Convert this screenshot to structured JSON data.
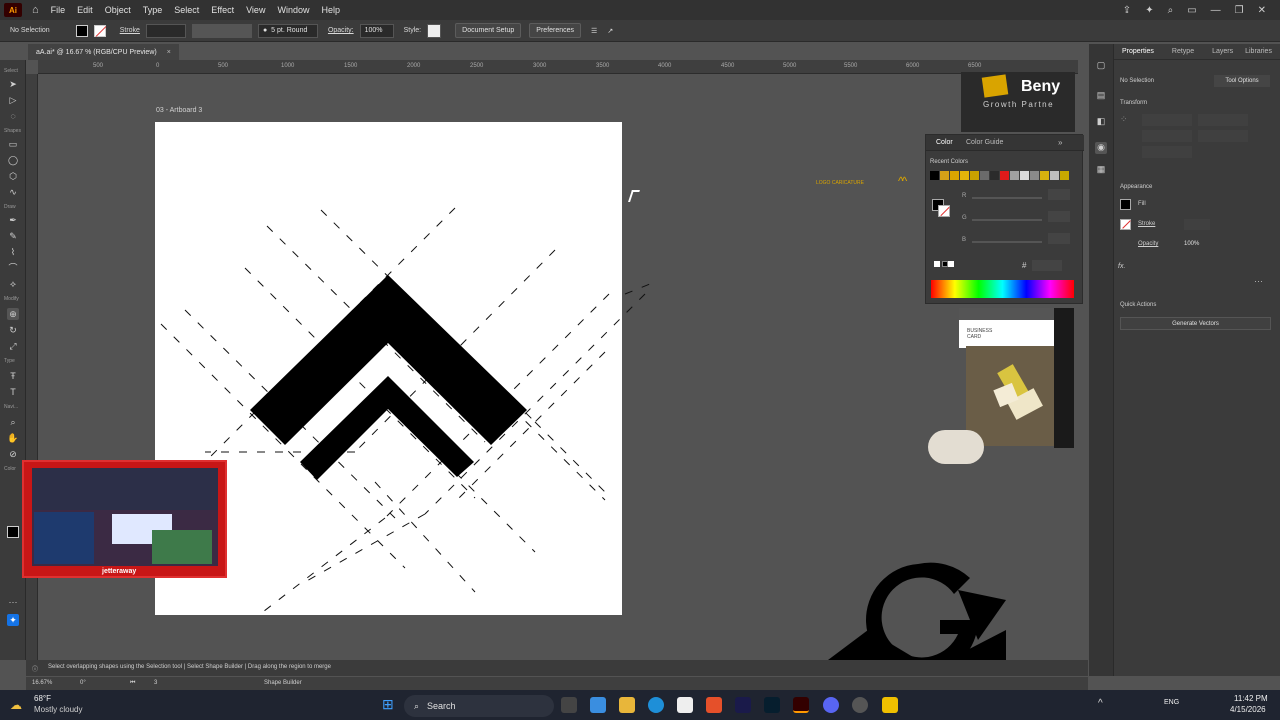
{
  "app": {
    "logo_text": "Ai",
    "menu": [
      "File",
      "Edit",
      "Object",
      "Type",
      "Select",
      "Effect",
      "View",
      "Window",
      "Help"
    ]
  },
  "control_bar": {
    "selection_label": "No Selection",
    "stroke_label": "Stroke",
    "brush_label": "5 pt. Round",
    "opacity_label": "Opacity:",
    "opacity_value": "100%",
    "style_label": "Style:",
    "document_setup": "Document Setup",
    "preferences": "Preferences"
  },
  "document": {
    "tab_title": "aA.ai* @ 16.67 % (RGB/CPU Preview)",
    "close_glyph": "×",
    "artboard_label": "03 - Artboard 3"
  },
  "rulers": {
    "h_labels": [
      "500",
      "0",
      "500",
      "1000",
      "1500",
      "2000",
      "2500",
      "3000",
      "3500",
      "4000",
      "4500",
      "5000",
      "5500",
      "6000",
      "6500"
    ]
  },
  "toolbar": {
    "groups": [
      "Select",
      "Shapes",
      "Draw",
      "Modify",
      "Type",
      "Navi...",
      "Color"
    ]
  },
  "properties": {
    "tabs": [
      "Properties",
      "Retype",
      "Layers",
      "Libraries"
    ],
    "no_selection": "No Selection",
    "tool_options": "Tool Options",
    "transform_title": "Transform",
    "appearance_title": "Appearance",
    "fill_label": "Fill",
    "stroke_label": "Stroke",
    "opacity_label": "Opacity",
    "opacity_value": "100%",
    "fx_label": "fx.",
    "quick_actions_title": "Quick Actions",
    "generate_vectors": "Generate Vectors"
  },
  "color_panel": {
    "tabs": [
      "Color",
      "Color Guide"
    ],
    "recent_colors_label": "Recent Colors",
    "recent_colors": [
      "#000000",
      "#d4a017",
      "#d9a400",
      "#e3b40a",
      "#c9a100",
      "#6b6b6b",
      "#2b2b2b",
      "#e01a1a",
      "#a0a0a0",
      "#d9d9d9",
      "#8a8a8a",
      "#d6b10e",
      "#bfbfbf",
      "#c8a800"
    ],
    "channel_labels": [
      "R",
      "G",
      "B"
    ],
    "hex_label": "#"
  },
  "canvas_labels": {
    "logo_caricature": "LOGO CARICATURE",
    "brand_text": "Beny",
    "brand_tagline": "Growth Partne",
    "business_card_line1": "BUSINESS",
    "business_card_line2": "CARD"
  },
  "status": {
    "hint_text": "Select overlapping shapes using the Selection tool  |  Select Shape Builder  |  Drag along the region to merge",
    "zoom": "16.67%",
    "rotation": "0°",
    "artboard_number": "3",
    "tool_name": "Shape Builder"
  },
  "webcam": {
    "streamer_name": "jetteraway"
  },
  "taskbar": {
    "weather_temp": "68°F",
    "weather_desc": "Mostly cloudy",
    "search_label": "Search",
    "language": "ENG",
    "time": "11:42 PM",
    "date": "4/15/2026"
  },
  "colors": {
    "accent_red": "#e03030",
    "accent_gold": "#d9a400",
    "panel_bg": "#3b3b3b",
    "pasteboard": "#535353"
  }
}
